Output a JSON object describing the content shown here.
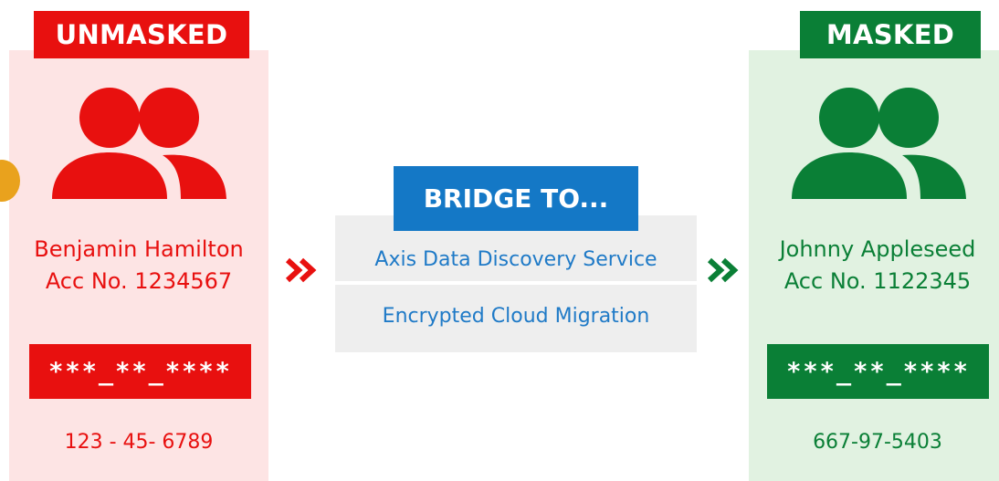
{
  "colors": {
    "unmasked_accent": "#e8100f",
    "unmasked_bg": "#fde4e4",
    "masked_accent": "#0a7f36",
    "masked_bg": "#e1f2e1",
    "bridge_accent": "#1478c6",
    "bridge_bg": "#eeeeee",
    "orange_dot": "#e9a21d"
  },
  "unmasked": {
    "header": "UNMASKED",
    "icon": "people-icon",
    "name": "Benjamin Hamilton",
    "account": "Acc No. 1234567",
    "mask": "***_**_****",
    "ssn": "123 - 45- 6789"
  },
  "bridge": {
    "title": "BRIDGE TO...",
    "items": [
      "Axis Data Discovery Service",
      "Encrypted Cloud Migration"
    ],
    "arrow_icon": "double-chevron-right-icon"
  },
  "masked": {
    "header": "MASKED",
    "icon": "people-icon",
    "name": "Johnny Appleseed",
    "account": "Acc No. 1122345",
    "mask": "***_**_****",
    "ssn": "667-97-5403"
  }
}
